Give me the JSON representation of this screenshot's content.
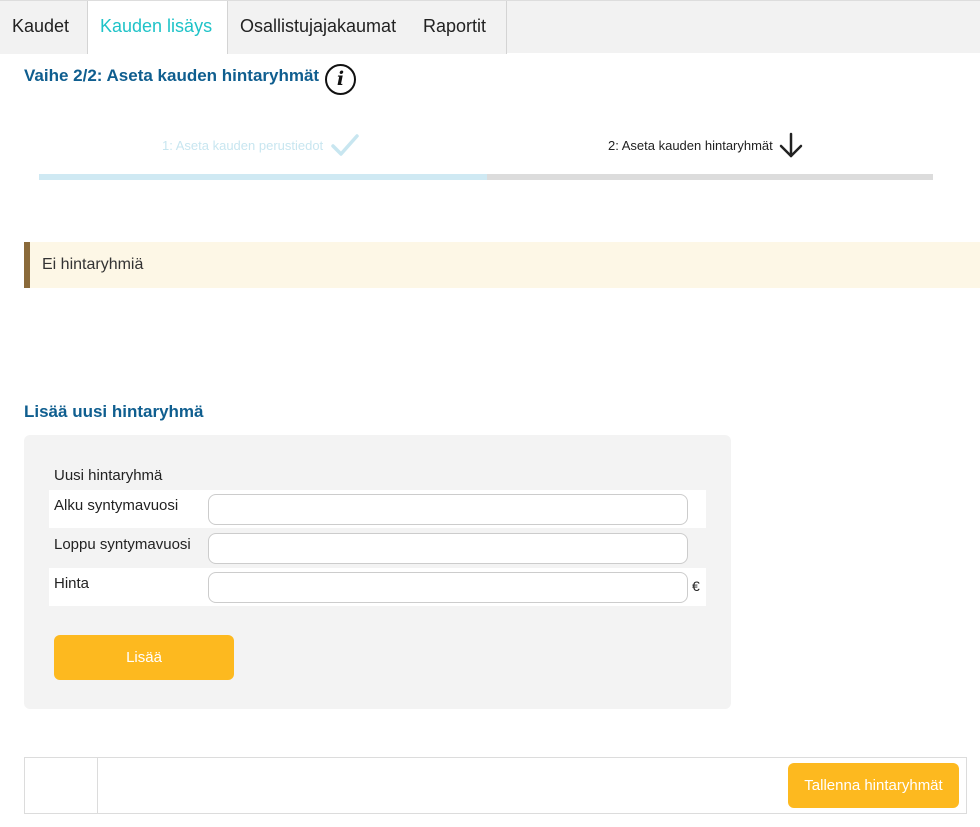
{
  "tabs": [
    {
      "label": "Kaudet",
      "active": false
    },
    {
      "label": "Kauden lisäys",
      "active": true
    },
    {
      "label": "Osallistujajakaumat",
      "active": false
    },
    {
      "label": "Raportit",
      "active": false
    }
  ],
  "page": {
    "title": "Vaihe 2/2: Aseta kauden hintaryhmät",
    "info_icon": "info-icon"
  },
  "steps": [
    {
      "label": "1: Aseta kauden perustiedot",
      "status": "done",
      "icon": "check-icon"
    },
    {
      "label": "2: Aseta kauden hintaryhmät",
      "status": "current",
      "icon": "arrow-down-icon"
    }
  ],
  "progress": {
    "completed_steps": 1,
    "total_steps": 2
  },
  "notice": {
    "text": "Ei hintaryhmiä"
  },
  "new_group": {
    "section_title": "Lisää uusi hintaryhmä",
    "form_heading": "Uusi hintaryhmä",
    "fields": [
      {
        "label": "Alku syntymavuosi",
        "value": "",
        "placeholder": ""
      },
      {
        "label": "Loppu syntymavuosi",
        "value": "",
        "placeholder": ""
      },
      {
        "label": "Hinta",
        "value": "",
        "placeholder": "",
        "suffix": "€"
      }
    ],
    "add_label": "Lisää"
  },
  "footer": {
    "save_label": "Tallenna hintaryhmät"
  },
  "colors": {
    "accent_tab": "#1fc3c8",
    "heading": "#0f5e8f",
    "button": "#fdb91f",
    "notice_bg": "#fdf7e6",
    "notice_border": "#8a6a3a"
  }
}
